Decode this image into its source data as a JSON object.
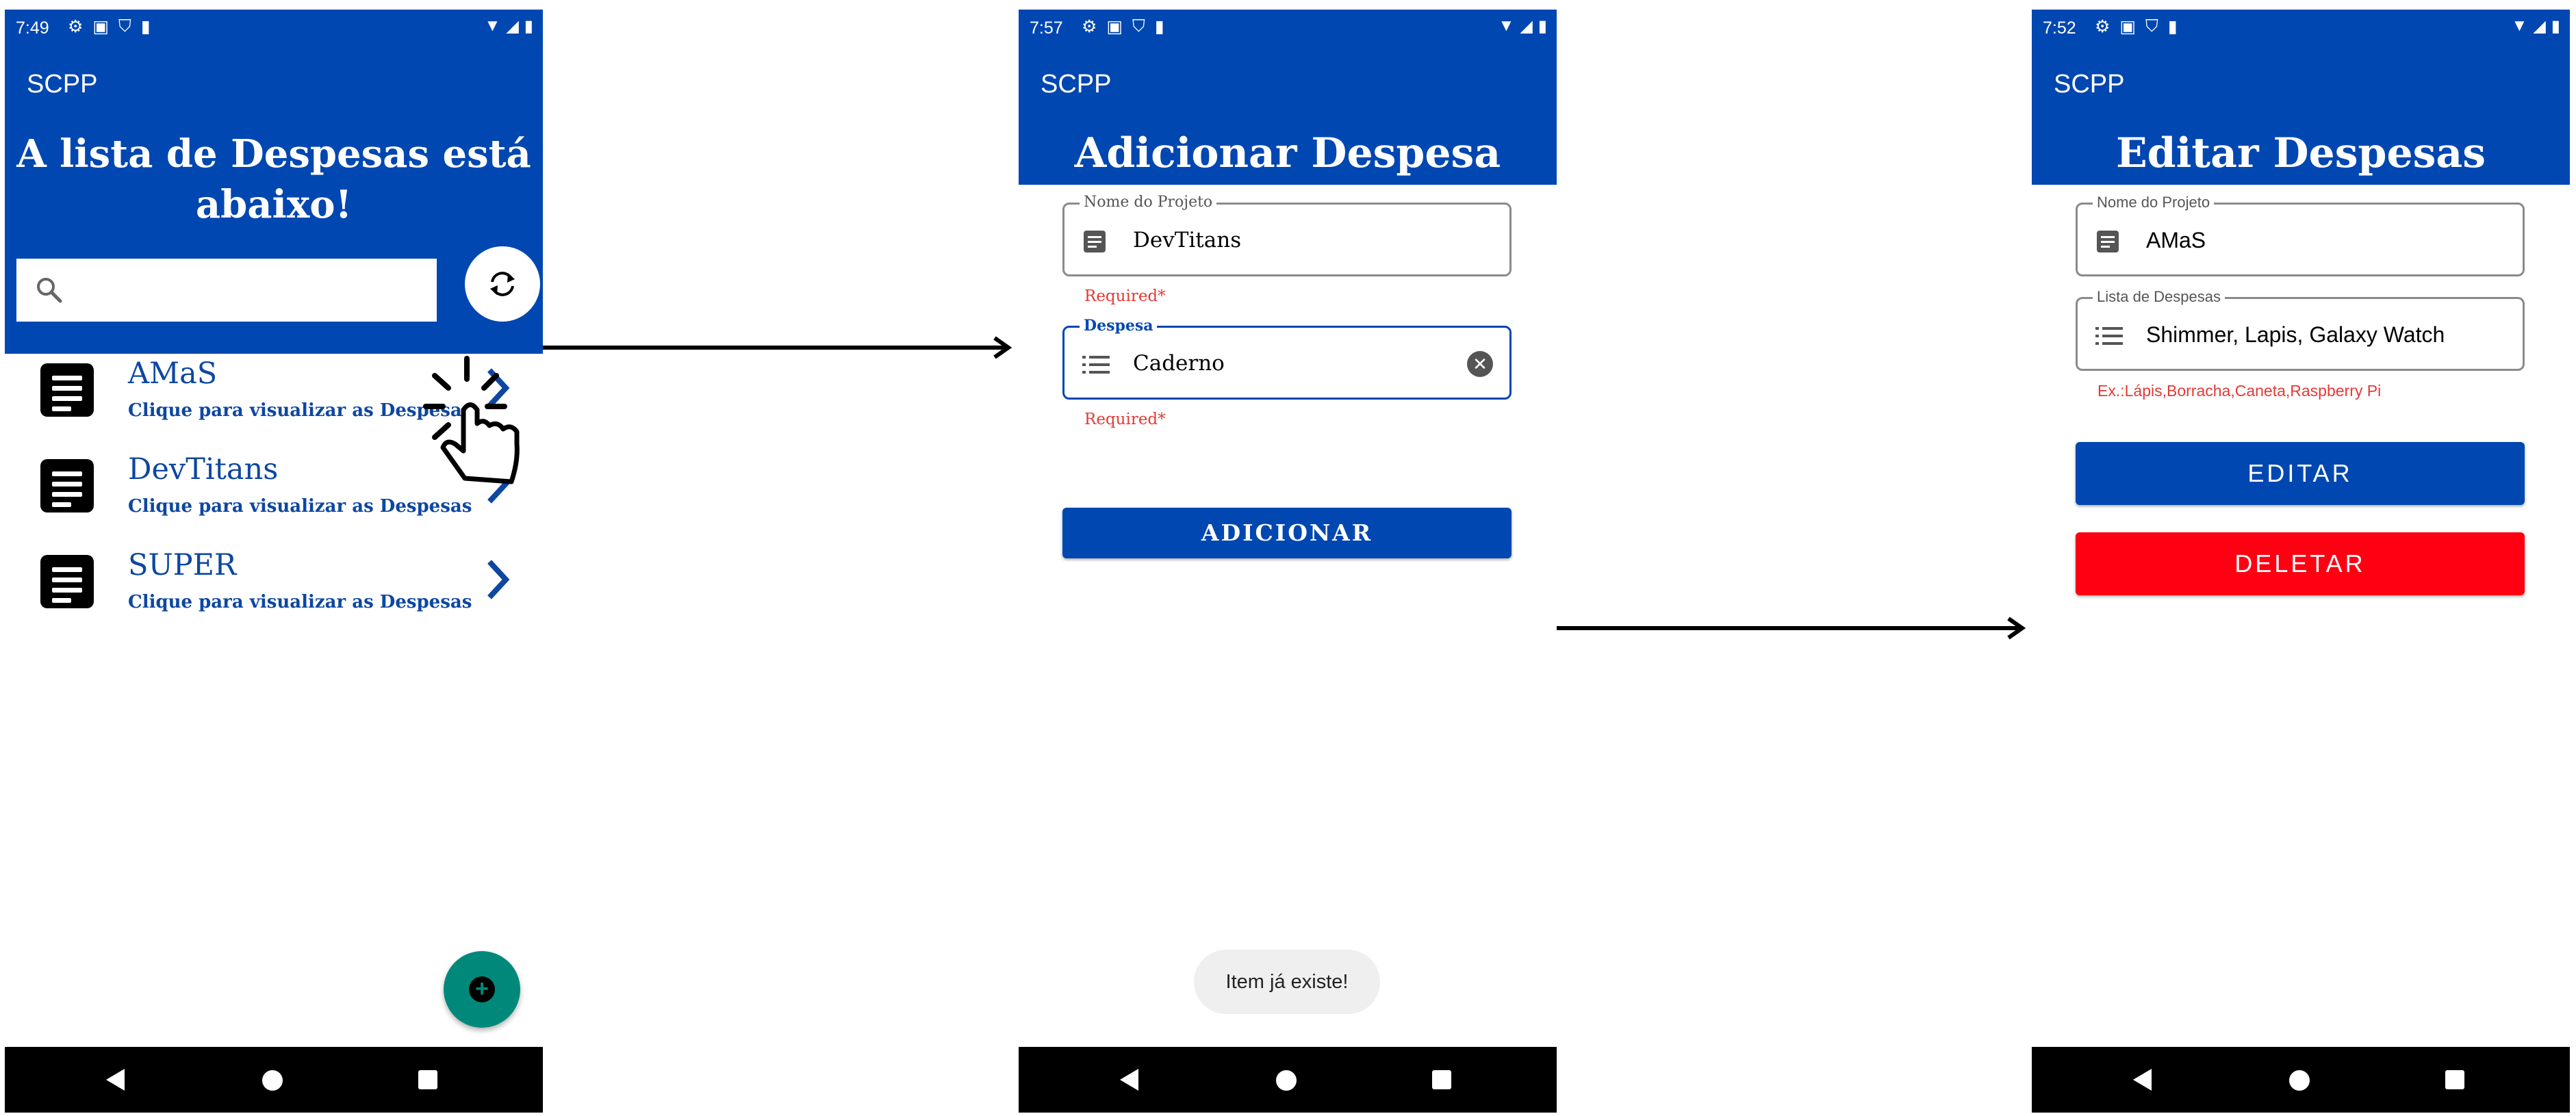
{
  "app_title": "SCPP",
  "screens": [
    {
      "time": "7:49",
      "headline_line1": "A lista de Despesas está",
      "headline_line2": "abaixo!",
      "search_placeholder": "",
      "items": [
        {
          "name": "AMaS",
          "subtitle": "Clique para visualizar as Despesas"
        },
        {
          "name": "DevTitans",
          "subtitle": "Clique para visualizar as Despesas"
        },
        {
          "name": "SUPER",
          "subtitle": "Clique para visualizar as Despesas"
        }
      ],
      "fab_icon": "add-circle-icon"
    },
    {
      "time": "7:57",
      "headline": "Adicionar Despesa",
      "project_label": "Nome do Projeto",
      "project_value": "DevTitans",
      "project_error": "Required*",
      "expense_label": "Despesa",
      "expense_value": "Caderno",
      "expense_error": "Required*",
      "add_button": "ADICIONAR",
      "toast": "Item já existe!"
    },
    {
      "time": "7:52",
      "headline": "Editar Despesas",
      "project_label": "Nome do Projeto",
      "project_value": "AMaS",
      "list_label": "Lista de Despesas",
      "list_value": "Shimmer,  Lapis,  Galaxy Watch",
      "helper_text": "Ex.:Lápis,Borracha,Caneta,Raspberry Pi",
      "edit_button": "EDITAR",
      "delete_button": "DELETAR"
    }
  ],
  "colors": {
    "primary": "#0147b1",
    "title_blue": "#0d47a1",
    "fab": "#00897b",
    "delete": "#ff0013",
    "error": "#e53935"
  }
}
